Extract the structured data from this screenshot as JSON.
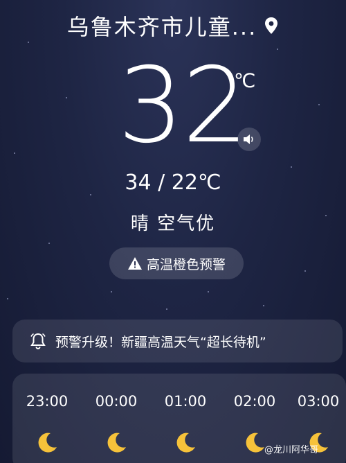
{
  "location": {
    "name": "乌鲁木齐市儿童...",
    "pin_icon": "location-pin-icon"
  },
  "current": {
    "temperature": "32",
    "unit": "℃",
    "range": "34 / 22℃",
    "condition": "晴  空气优"
  },
  "alert": {
    "label": "高温橙色预警",
    "icon": "warning-triangle-icon"
  },
  "news": {
    "text": "预警升级！新疆高温天气“超长待机”",
    "icon": "bell-icon"
  },
  "hourly": [
    {
      "time": "23:00",
      "icon": "moon-icon"
    },
    {
      "time": "00:00",
      "icon": "moon-icon"
    },
    {
      "time": "01:00",
      "icon": "moon-icon"
    },
    {
      "time": "02:00",
      "icon": "moon-icon"
    },
    {
      "time": "03:00",
      "icon": "moon-icon"
    }
  ],
  "watermark": {
    "text": "@龙川阿华哥"
  },
  "colors": {
    "moon": "#f6c23a",
    "background": "#1e2544"
  }
}
